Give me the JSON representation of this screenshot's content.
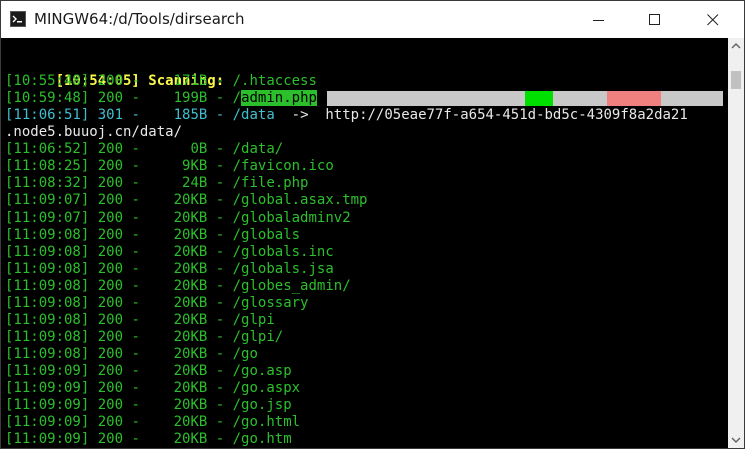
{
  "window": {
    "title": "MINGW64:/d/Tools/dirsearch",
    "icons": {
      "app": "mingw-app-icon",
      "minimize": "minimize-icon",
      "maximize": "maximize-icon",
      "close": "close-icon"
    }
  },
  "terminal": {
    "header": {
      "time": "[10:54:05]",
      "text": " Scanning:"
    },
    "rows": [
      {
        "time": "[10:55:48]",
        "code": "200",
        "size": "171B",
        "path": "/.htaccess",
        "color": "green"
      },
      {
        "time": "[10:59:48]",
        "code": "200",
        "size": "199B",
        "path": "admin.php",
        "color": "green",
        "highlight": true
      },
      {
        "time": "[11:06:51]",
        "code": "301",
        "size": "185B",
        "path": "/data",
        "color": "cyan",
        "redirect": "http://05eae77f-a654-451d-bd5c-4309f8a2da21"
      },
      {
        "time": "[11:06:52]",
        "code": "200",
        "size": "0B",
        "path": "/data/",
        "color": "green"
      },
      {
        "time": "[11:08:25]",
        "code": "200",
        "size": "9KB",
        "path": "/favicon.ico",
        "color": "green"
      },
      {
        "time": "[11:08:32]",
        "code": "200",
        "size": "24B",
        "path": "/file.php",
        "color": "green"
      },
      {
        "time": "[11:09:07]",
        "code": "200",
        "size": "20KB",
        "path": "/global.asax.tmp",
        "color": "green"
      },
      {
        "time": "[11:09:07]",
        "code": "200",
        "size": "20KB",
        "path": "/globaladminv2",
        "color": "green"
      },
      {
        "time": "[11:09:08]",
        "code": "200",
        "size": "20KB",
        "path": "/globals",
        "color": "green"
      },
      {
        "time": "[11:09:08]",
        "code": "200",
        "size": "20KB",
        "path": "/globals.inc",
        "color": "green"
      },
      {
        "time": "[11:09:08]",
        "code": "200",
        "size": "20KB",
        "path": "/globals.jsa",
        "color": "green"
      },
      {
        "time": "[11:09:08]",
        "code": "200",
        "size": "20KB",
        "path": "/globes_admin/",
        "color": "green"
      },
      {
        "time": "[11:09:08]",
        "code": "200",
        "size": "20KB",
        "path": "/glossary",
        "color": "green"
      },
      {
        "time": "[11:09:08]",
        "code": "200",
        "size": "20KB",
        "path": "/glpi",
        "color": "green"
      },
      {
        "time": "[11:09:08]",
        "code": "200",
        "size": "20KB",
        "path": "/glpi/",
        "color": "green"
      },
      {
        "time": "[11:09:08]",
        "code": "200",
        "size": "20KB",
        "path": "/go",
        "color": "green"
      },
      {
        "time": "[11:09:09]",
        "code": "200",
        "size": "20KB",
        "path": "/go.asp",
        "color": "green"
      },
      {
        "time": "[11:09:09]",
        "code": "200",
        "size": "20KB",
        "path": "/go.aspx",
        "color": "green"
      },
      {
        "time": "[11:09:09]",
        "code": "200",
        "size": "20KB",
        "path": "/go.jsp",
        "color": "green"
      },
      {
        "time": "[11:09:09]",
        "code": "200",
        "size": "20KB",
        "path": "/go.html",
        "color": "green"
      },
      {
        "time": "[11:09:09]",
        "code": "200",
        "size": "20KB",
        "path": "/go.htm",
        "color": "green"
      }
    ],
    "wrap_line": ".node5.buuoj.cn/data/",
    "arrow": "->",
    "progress_segments": [
      {
        "color": "#c8c8c8"
      },
      {
        "color": "#00e000"
      },
      {
        "color": "#c8c8c8"
      },
      {
        "color": "#f08080"
      },
      {
        "color": "#c8c8c8"
      }
    ]
  },
  "colors": {
    "green": "#2cbf2c",
    "cyan": "#3fbfd0",
    "yellow": "#f7f74a",
    "white": "#e8e8e8",
    "background": "#000000"
  }
}
